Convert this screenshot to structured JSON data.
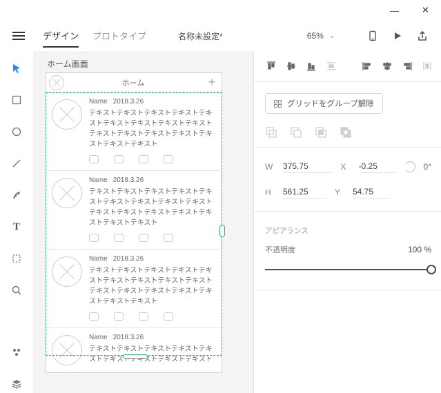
{
  "window": {
    "minimize": "—",
    "close": "✕"
  },
  "topbar": {
    "tabs": {
      "design": "デザイン",
      "prototype": "プロトタイプ"
    },
    "doc_title": "名称未設定*",
    "zoom": "65%"
  },
  "artboard": {
    "label": "ホーム画面",
    "title": "ホーム",
    "card": {
      "name": "Name",
      "date": "2018.3.26",
      "text": "テキストテキストテキストテキストテキストテキストテキストテキストテキストテキストテキストテキストテキストテキストテキストテキスト"
    }
  },
  "inspector": {
    "grid_btn": "グリッドをグループ解除",
    "w_label": "W",
    "w_val": "375.75",
    "x_label": "X",
    "x_val": "-0.25",
    "h_label": "H",
    "h_val": "561.25",
    "y_label": "Y",
    "y_val": "54.75",
    "rot_val": "0°",
    "appearance_label": "アピアランス",
    "opacity_label": "不透明度",
    "opacity_val": "100 %"
  }
}
